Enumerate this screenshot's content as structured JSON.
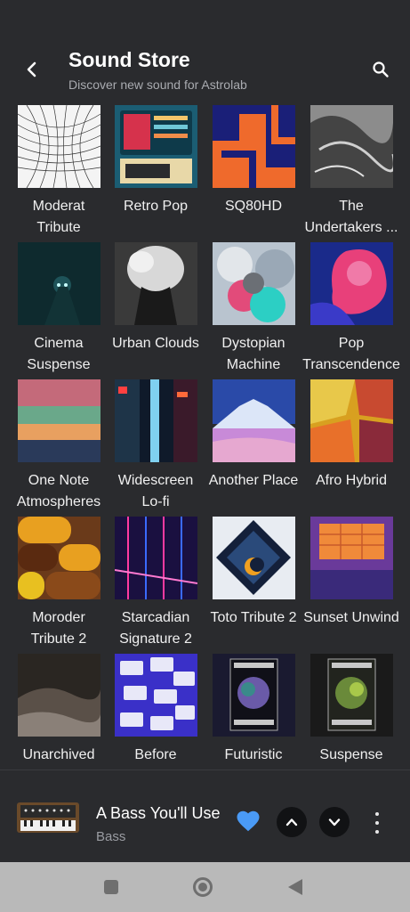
{
  "header": {
    "title": "Sound Store",
    "subtitle": "Discover new sound for Astrolab"
  },
  "grid": {
    "items": [
      {
        "label": "Moderat Tribute"
      },
      {
        "label": "Retro Pop"
      },
      {
        "label": "SQ80HD"
      },
      {
        "label": "The Undertakers ..."
      },
      {
        "label": "Cinema Suspense"
      },
      {
        "label": "Urban Clouds"
      },
      {
        "label": "Dystopian Machine"
      },
      {
        "label": "Pop Transcendence"
      },
      {
        "label": "One Note Atmospheres"
      },
      {
        "label": "Widescreen Lo-fi"
      },
      {
        "label": "Another Place"
      },
      {
        "label": "Afro Hybrid"
      },
      {
        "label": "Moroder Tribute 2"
      },
      {
        "label": "Starcadian Signature 2"
      },
      {
        "label": "Toto Tribute 2"
      },
      {
        "label": "Sunset Unwind"
      },
      {
        "label": "Unarchived"
      },
      {
        "label": "Before"
      },
      {
        "label": "Futuristic"
      },
      {
        "label": "Suspense"
      }
    ]
  },
  "player": {
    "title": "A Bass You'll Use",
    "subtitle": "Bass",
    "favorite": true,
    "heart_color": "#4a9af5"
  },
  "icons": {
    "back": "arrow-back-icon",
    "search": "search-icon",
    "heart": "heart-icon",
    "up": "chevron-up-icon",
    "down": "chevron-down-icon",
    "more": "more-vertical-icon"
  }
}
